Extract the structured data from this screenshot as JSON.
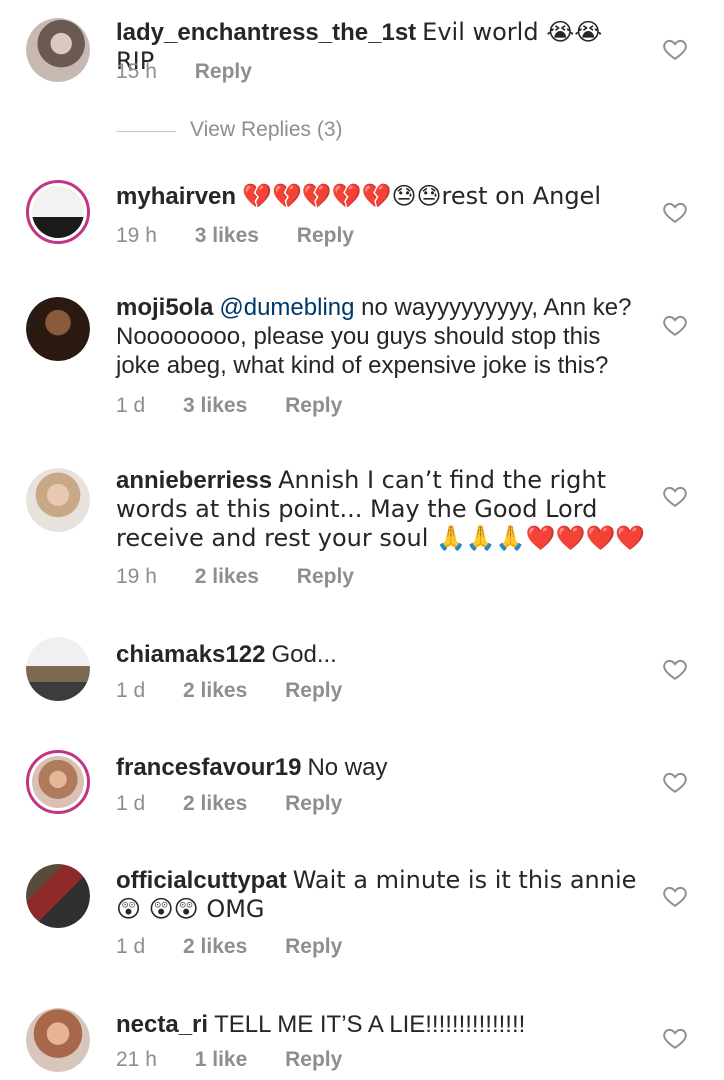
{
  "comments": [
    {
      "user": "lady_enchantress_the_1st",
      "text": "Evil world 😭😭 RIP",
      "time": "15 h",
      "likes": "",
      "reply": "Reply"
    },
    {
      "user": "myhairven",
      "text": "💔💔💔💔💔😓😓rest on Angel",
      "time": "19 h",
      "likes": "3 likes",
      "reply": "Reply"
    },
    {
      "user": "moji5ola",
      "mention": "@dumebling",
      "text": "no wayyyyyyyyy, Ann ke? Noooooooo, please you guys should stop this joke abeg, what kind of expensive joke is this?",
      "time": "1 d",
      "likes": "3 likes",
      "reply": "Reply"
    },
    {
      "user": "annieberriess",
      "text": "Annish I can’t find the right words at this point... May the Good Lord receive and rest your soul 🙏🙏🙏❤️❤️❤️❤️",
      "time": "19 h",
      "likes": "2 likes",
      "reply": "Reply"
    },
    {
      "user": "chiamaks122",
      "text": "God...",
      "time": "1 d",
      "likes": "2 likes",
      "reply": "Reply"
    },
    {
      "user": "francesfavour19",
      "text": "No way",
      "time": "1 d",
      "likes": "2 likes",
      "reply": "Reply"
    },
    {
      "user": "officialcuttypat",
      "text": "Wait a minute is it this annie😲 😲😲 OMG",
      "time": "1 d",
      "likes": "2 likes",
      "reply": "Reply"
    },
    {
      "user": "necta_ri",
      "text": "TELL ME IT’S A LIE!!!!!!!!!!!!!!!",
      "time": "21 h",
      "likes": "1 like",
      "reply": "Reply"
    }
  ],
  "view_replies": "View Replies (3)",
  "colors": {
    "text": "#262626",
    "meta": "#8e8e8e",
    "mention": "#00376b",
    "ring": "#c13584"
  }
}
